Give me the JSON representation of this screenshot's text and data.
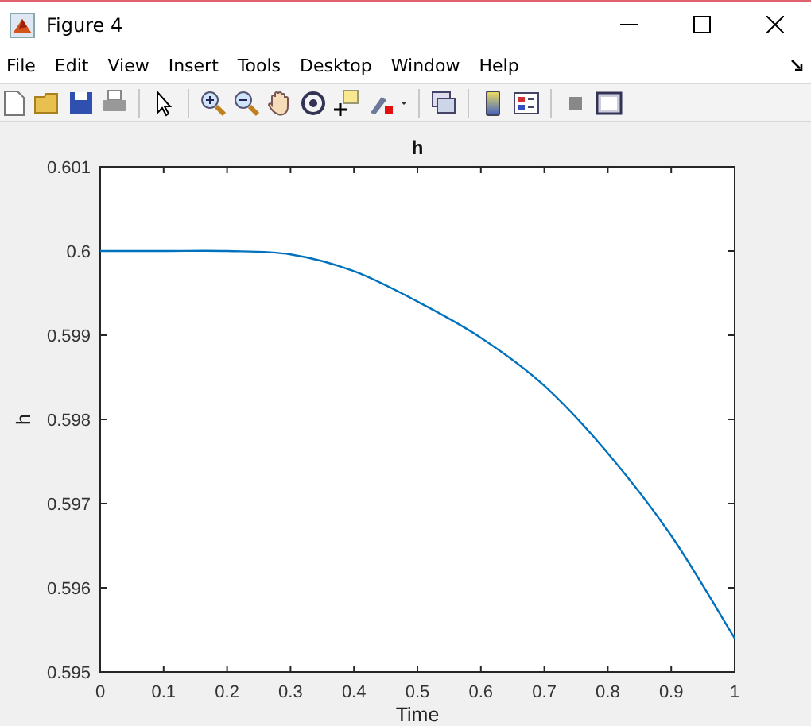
{
  "window": {
    "title": "Figure 4"
  },
  "menu": [
    "File",
    "Edit",
    "View",
    "Insert",
    "Tools",
    "Desktop",
    "Window",
    "Help"
  ],
  "axes": {
    "chart_data": {
      "type": "line",
      "title": "h",
      "xlabel": "Time",
      "ylabel": "h",
      "x": [
        0,
        0.1,
        0.2,
        0.3,
        0.4,
        0.5,
        0.6,
        0.7,
        0.8,
        0.9,
        1
      ],
      "series": [
        {
          "color": "#0072bd",
          "values": [
            0.6,
            0.6,
            0.6,
            0.59996,
            0.59976,
            0.5994,
            0.59897,
            0.5984,
            0.5976,
            0.59662,
            0.5954
          ]
        }
      ],
      "xlim": [
        0,
        1
      ],
      "ylim": [
        0.595,
        0.601
      ],
      "xticks": [
        0,
        0.1,
        0.2,
        0.3,
        0.4,
        0.5,
        0.6,
        0.7,
        0.8,
        0.9,
        1
      ],
      "yticks": [
        0.595,
        0.596,
        0.597,
        0.598,
        0.599,
        0.6,
        0.601
      ]
    }
  }
}
